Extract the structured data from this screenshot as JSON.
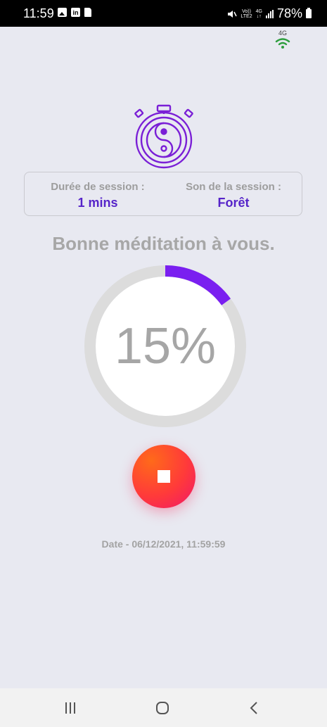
{
  "status_bar": {
    "time": "11:59",
    "network_top": "Vo))",
    "network_bottom": "LTE2",
    "data_top": "4G",
    "data_bottom": "↓↑",
    "battery": "78%"
  },
  "network_indicator": {
    "label": "4G",
    "icon": "wifi-icon",
    "color": "#2e9e3e"
  },
  "logo": {
    "icon": "yin-yang-stopwatch-icon",
    "color": "#7a1fd6"
  },
  "session": {
    "duration_label": "Durée de session :",
    "duration_value": "1 mins",
    "sound_label": "Son de la session :",
    "sound_value": "Forêt"
  },
  "greeting": "Bonne méditation à vous.",
  "progress": {
    "percent_text": "15%",
    "value": 0.15,
    "color": "#7a1ff0",
    "track_color": "#dcdcdc"
  },
  "stop_button": {
    "icon": "stop-icon"
  },
  "date_text": "Date - 06/12/2021, 11:59:59",
  "nav": {
    "recent_icon": "recent-apps-icon",
    "home_icon": "home-icon",
    "back_icon": "back-icon"
  }
}
